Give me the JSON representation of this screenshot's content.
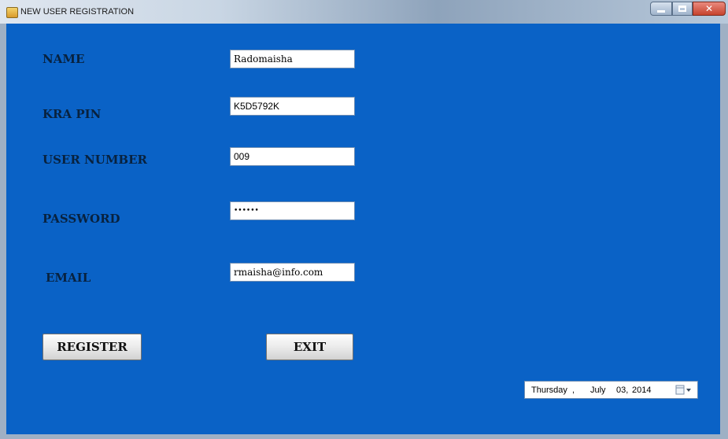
{
  "window": {
    "title": "NEW USER REGISTRATION"
  },
  "form": {
    "name": {
      "label": "NAME",
      "value": "Radomaisha"
    },
    "kra_pin": {
      "label": "KRA PIN",
      "value": "K5D5792K"
    },
    "user_number": {
      "label": "USER NUMBER",
      "value": "009"
    },
    "password": {
      "label": "PASSWORD",
      "value": "••••••"
    },
    "email": {
      "label": "EMAIL",
      "value": "rmaisha@info.com"
    }
  },
  "buttons": {
    "register": "REGISTER",
    "exit": "EXIT"
  },
  "date_picker": {
    "weekday": "Thursday",
    "sep1": ",",
    "month": "July",
    "day": "03,",
    "year": "2014"
  },
  "colors": {
    "client_background": "#0a62c6",
    "label_text": "#08223f"
  }
}
